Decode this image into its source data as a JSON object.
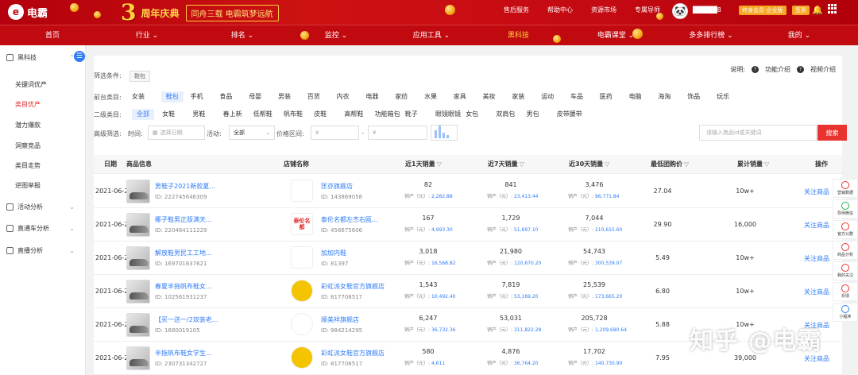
{
  "header": {
    "logo_text": "电霸",
    "banner_num": "3",
    "banner_title": "周年庆典",
    "banner_slogan": "同舟三载 电霸筑梦远航",
    "top_links": [
      "售后服务",
      "帮助中心",
      "资源市场",
      "专属导师"
    ],
    "vip_badge": "终身会员-企业版",
    "msg_badge": "签到",
    "username_suffix": "8"
  },
  "nav": {
    "items": [
      "首页",
      "行业",
      "排名",
      "监控",
      "应用工具",
      "黑科技",
      "电霸课堂",
      "多多排行榜",
      "我的"
    ],
    "active_index": 5
  },
  "sidebar": {
    "groups": [
      "黑科技",
      "活动分析",
      "直通车分析",
      "直播分析"
    ],
    "subitems": [
      "关键词优产",
      "类目优产",
      "潜力爆款",
      "洞察竞品",
      "类目走势",
      "逆图举报"
    ],
    "active_sub": 1
  },
  "filters": {
    "cond_label": "筛选条件:",
    "cond_tag": "鞋包",
    "help_label": "说明:",
    "feature_intro": "功能介绍",
    "video_intro": "视频介绍",
    "front_label": "前台类目:",
    "front_cats": [
      "女装",
      "鞋包",
      "手机",
      "食品",
      "母婴",
      "男装",
      "百货",
      "内衣",
      "电器",
      "家纺",
      "水果",
      "家具",
      "美妆",
      "家装",
      "运动",
      "车品",
      "医药",
      "电脑",
      "海淘",
      "饰品",
      "玩乐"
    ],
    "front_active": 1,
    "second_label": "二级类目:",
    "second_cats": [
      "全部",
      "女鞋",
      "男鞋",
      "春上新",
      "低帮鞋",
      "帆布鞋",
      "皮鞋",
      "高帮鞋",
      "功能箱包",
      "靴子",
      "眼镜眼镜",
      "女包",
      "双肩包",
      "男包",
      "皮带腰带"
    ],
    "second_active": 0,
    "adv_label": "高级筛选:",
    "time_label": "时间:",
    "time_placeholder": "选择日期",
    "activity_label": "活动:",
    "activity_value": "全部",
    "price_label": "价格区间:",
    "price_low": "¥",
    "price_dash": "-",
    "price_high": "¥",
    "search_placeholder": "请输入商品id或关键词",
    "search_button": "搜索"
  },
  "table": {
    "headers": [
      "日期",
      "商品信息",
      "店铺名称",
      "近1天销量",
      "近7天销量",
      "近30天销量",
      "最低团购价",
      "累计销量",
      "操作"
    ],
    "rows": [
      {
        "date": "2021-06-22",
        "name": "男鞋子2021新款夏...",
        "id": "ID: 222745646309",
        "shop": "匡亦旗舰店",
        "shop_id": "ID: 143869058",
        "shop_logo": "",
        "d1": "82",
        "d1r": "2,282.88",
        "d7": "841",
        "d7r": "23,413.44",
        "d30": "3,476",
        "d30r": "96,771.84",
        "price": "27.04",
        "total": "10w+",
        "action": "关注商品"
      },
      {
        "date": "2021-06-22",
        "name": "椰子鞋男正版满天...",
        "id": "ID: 220464111229",
        "shop": "泰伦名都左杰右瓯...",
        "shop_id": "ID: 456675606",
        "shop_logo": "泰伦名都",
        "d1": "167",
        "d1r": "4,993.30",
        "d7": "1,729",
        "d7r": "51,697.10",
        "d30": "7,044",
        "d30r": "210,615.60",
        "price": "29.90",
        "total": "16,000",
        "action": "关注商品"
      },
      {
        "date": "2021-06-22",
        "name": "解放鞋男民工工地...",
        "id": "ID: 169701637621",
        "shop": "加加内鞋",
        "shop_id": "ID: 81397",
        "shop_logo": "",
        "d1": "3,018",
        "d1r": "16,568.82",
        "d7": "21,980",
        "d7r": "120,670.20",
        "d30": "54,743",
        "d30r": "300,539.07",
        "price": "5.49",
        "total": "10w+",
        "action": "关注商品"
      },
      {
        "date": "2021-06-22",
        "name": "春夏半拖帆布鞋女...",
        "id": "ID: 102561931237",
        "shop": "彩虹派女鞋官方旗舰店",
        "shop_id": "ID: 817708517",
        "shop_logo": "",
        "d1": "1,543",
        "d1r": "10,492.40",
        "d7": "7,819",
        "d7r": "53,169.20",
        "d30": "25,539",
        "d30r": "173,665.20",
        "price": "6.80",
        "total": "10w+",
        "action": "关注商品"
      },
      {
        "date": "2021-06-22",
        "name": "【买一送一/2双装老...",
        "id": "ID: 1680019105",
        "shop": "顺美祥旗舰店",
        "shop_id": "ID: 984214295",
        "shop_logo": "",
        "d1": "6,247",
        "d1r": "36,732.36",
        "d7": "53,031",
        "d7r": "311,822.28",
        "d30": "205,728",
        "d30r": "1,209,680.64",
        "price": "5.88",
        "total": "10w+",
        "action": "关注商品"
      },
      {
        "date": "2021-06-22",
        "name": "半拖帆布鞋女学生...",
        "id": "ID: 230731342727",
        "shop": "彩虹派女鞋官方旗舰店",
        "shop_id": "ID: 817708517",
        "shop_logo": "",
        "d1": "580",
        "d1r": "4,611",
        "d7": "4,876",
        "d7r": "36,764.20",
        "d30": "17,702",
        "d30r": "140,730.90",
        "price": "7.95",
        "total": "39,000",
        "action": "关注商品"
      }
    ],
    "revenue_label": "销产（元）:"
  },
  "tools": [
    "营销数据",
    "导师微信",
    "官方公群",
    "商品分析",
    "我的关注",
    "反馈",
    "小程序"
  ],
  "watermark": "知乎 @电霸",
  "colors": {
    "brand_red": "#c10910",
    "accent_blue": "#2f7cf6",
    "button_red": "#e8332e",
    "banner_gold": "#ffcf3c"
  }
}
